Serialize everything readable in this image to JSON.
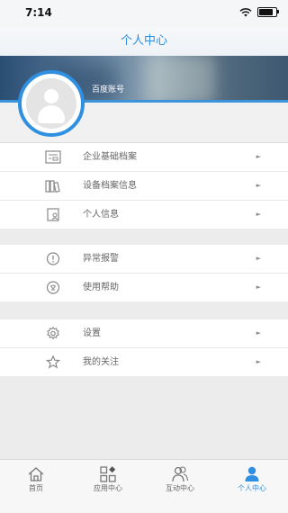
{
  "status_bar": {
    "time": "7:14"
  },
  "nav": {
    "title": "个人中心"
  },
  "profile": {
    "account_label": "百度账号"
  },
  "groups": [
    {
      "items": [
        {
          "label": "企业基础档案",
          "icon": "document-icon"
        },
        {
          "label": "设备档案信息",
          "icon": "books-icon"
        },
        {
          "label": "个人信息",
          "icon": "profile-card-icon"
        }
      ]
    },
    {
      "items": [
        {
          "label": "异常报警",
          "icon": "alert-icon"
        },
        {
          "label": "使用帮助",
          "icon": "help-icon"
        }
      ]
    },
    {
      "items": [
        {
          "label": "设置",
          "icon": "gear-icon"
        },
        {
          "label": "我的关注",
          "icon": "star-icon"
        }
      ]
    }
  ],
  "arrow_glyph": "►",
  "tabs": [
    {
      "label": "首页",
      "icon": "home-icon",
      "active": false
    },
    {
      "label": "应用中心",
      "icon": "apps-icon",
      "active": false
    },
    {
      "label": "互动中心",
      "icon": "people-icon",
      "active": false
    },
    {
      "label": "个人中心",
      "icon": "person-icon",
      "active": true
    }
  ],
  "colors": {
    "accent": "#2f8fe0",
    "background": "#ececec"
  }
}
